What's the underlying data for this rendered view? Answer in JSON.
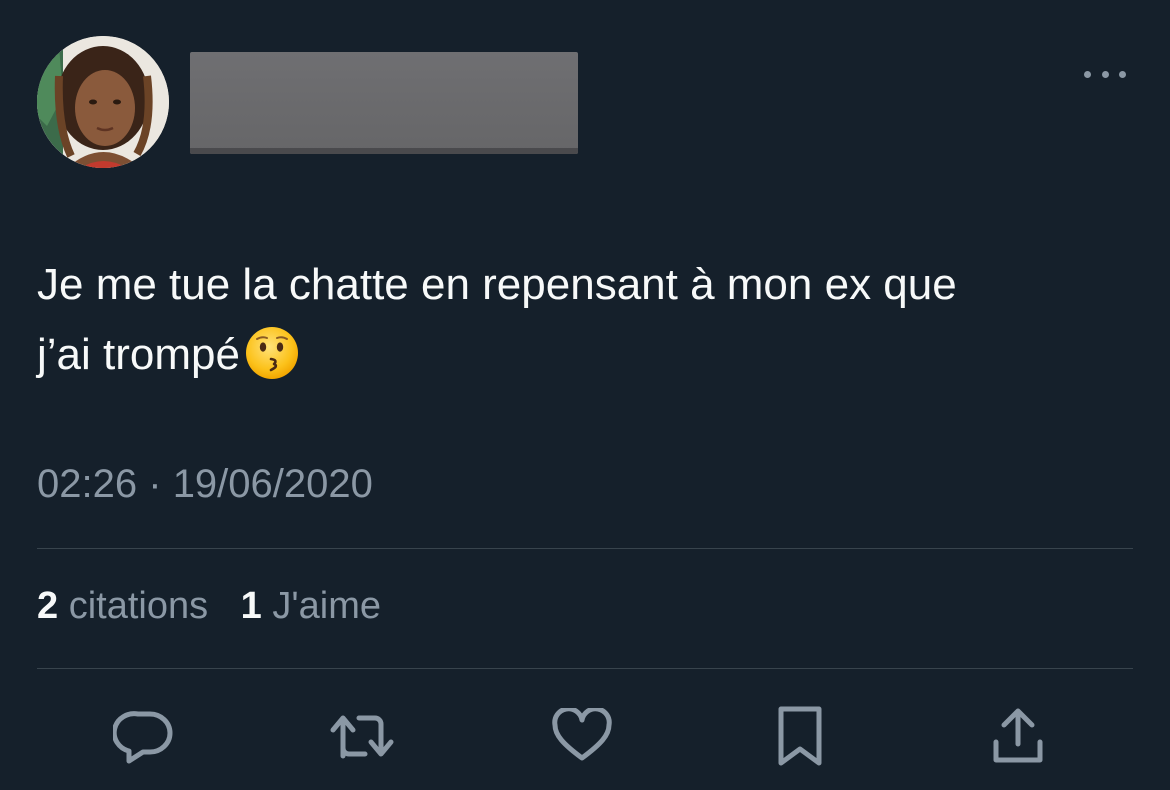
{
  "tweet": {
    "text_line1": "Je me tue la chatte en repensant à mon ex que",
    "text_line2": "j’ai trompé",
    "emoji": "kissing-face",
    "time": "02:26",
    "separator": "·",
    "date": "19/06/2020"
  },
  "stats": {
    "quotes_count": "2",
    "quotes_label": "citations",
    "likes_count": "1",
    "likes_label": "J'aime"
  },
  "actions": [
    "reply-icon",
    "retweet-icon",
    "like-icon",
    "bookmark-icon",
    "share-icon"
  ],
  "colors": {
    "background": "#15202b",
    "text": "#f7f9f9",
    "secondary": "#8b98a5",
    "divider": "#38444d"
  }
}
